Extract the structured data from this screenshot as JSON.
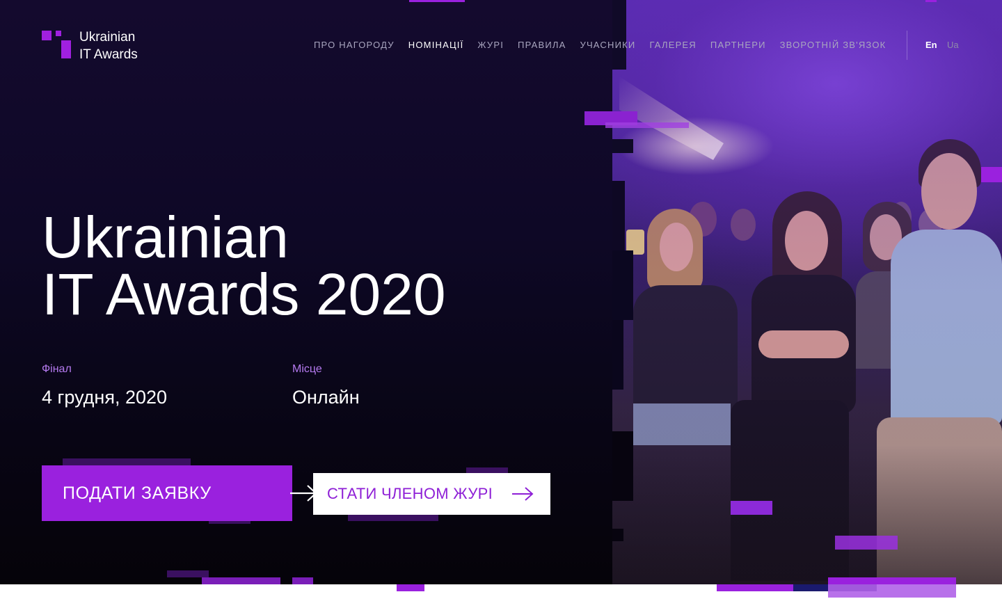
{
  "logo": {
    "line1": "Ukrainian",
    "line2": "IT Awards"
  },
  "nav": {
    "items": [
      {
        "label": "ПРО НАГОРОДУ",
        "active": false
      },
      {
        "label": "НОМІНАЦІЇ",
        "active": true
      },
      {
        "label": "ЖУРІ",
        "active": false
      },
      {
        "label": "ПРАВИЛА",
        "active": false
      },
      {
        "label": "УЧАСНИКИ",
        "active": false
      },
      {
        "label": "ГАЛЕРЕЯ",
        "active": false
      },
      {
        "label": "ПАРТНЕРИ",
        "active": false
      },
      {
        "label": "ЗВОРОТНІЙ ЗВ'ЯЗОК",
        "active": false
      }
    ],
    "lang_en": "En",
    "lang_ua": "Ua",
    "active_lang": "En"
  },
  "hero": {
    "title_line1": "Ukrainian",
    "title_line2": "IT Awards 2020",
    "final_label": "Фінал",
    "final_value": "4 грудня, 2020",
    "place_label": "Місце",
    "place_value": "Онлайн",
    "apply_button": "ПОДАТИ ЗАЯВКУ",
    "jury_button": "СТАТИ ЧЛЕНОМ ЖУРІ"
  },
  "colors": {
    "accent": "#9a21de",
    "accent_light": "#b57af0",
    "background": "#0e0826",
    "nav_text": "#a9a6bf"
  },
  "icons": [
    "arrow-right-icon",
    "logo-mark-icon"
  ]
}
